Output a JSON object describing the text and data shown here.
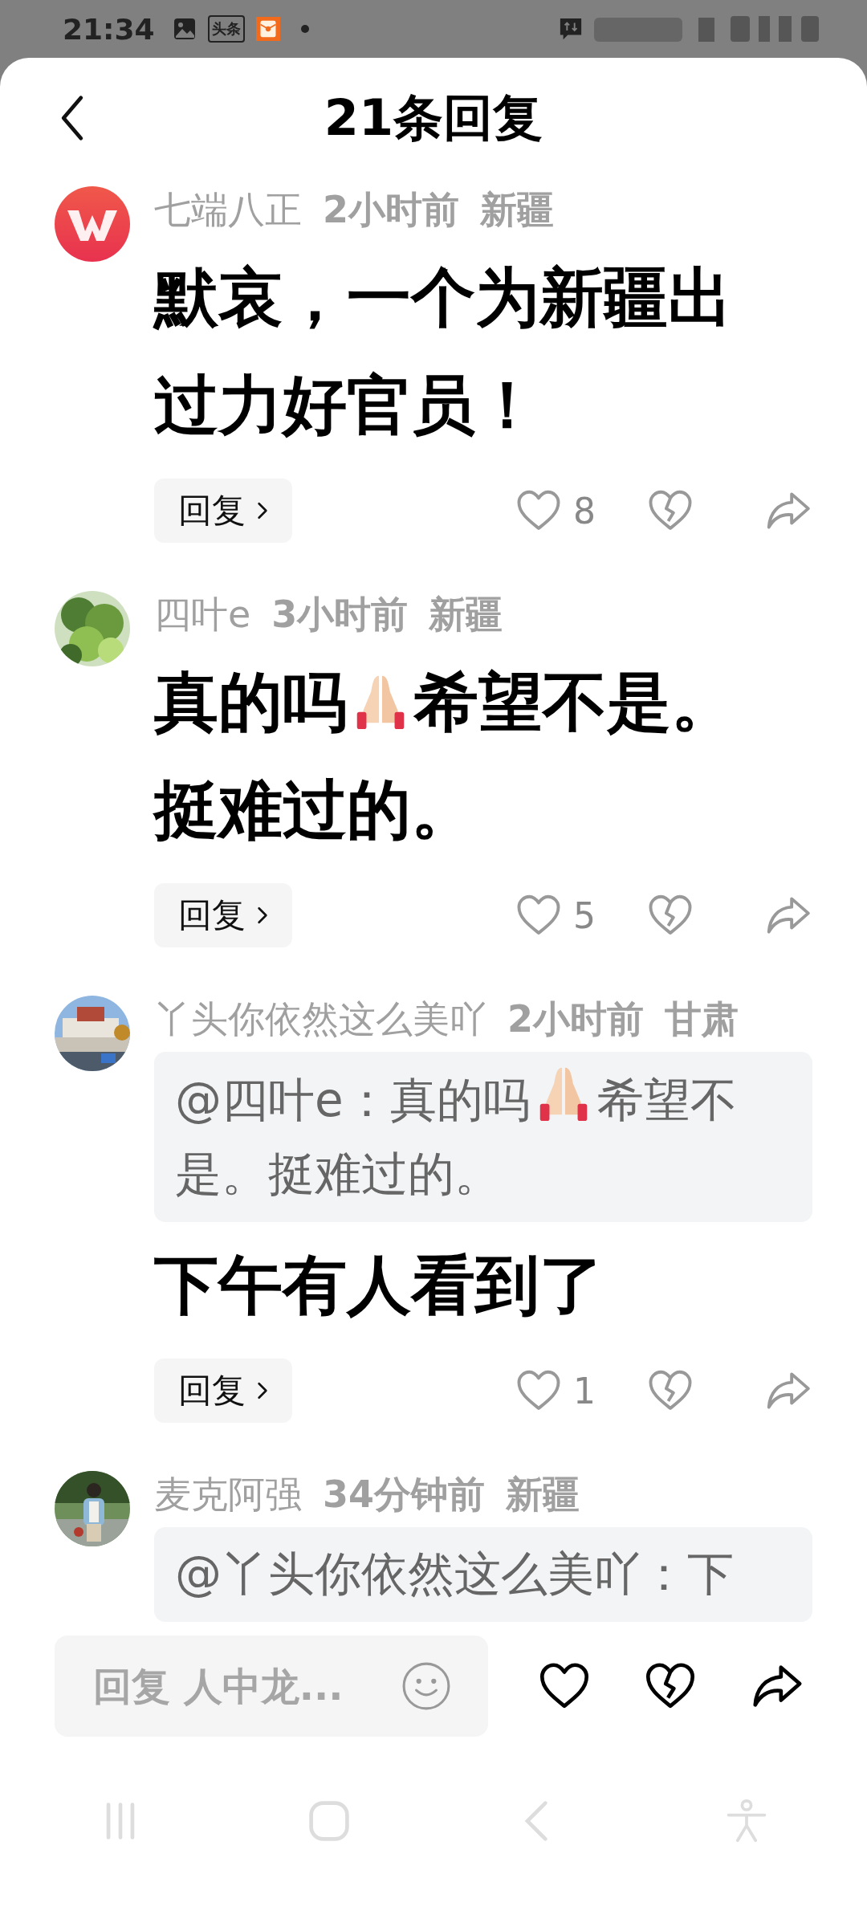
{
  "status_bar": {
    "time": "21:34",
    "app_badge": "头条"
  },
  "header": {
    "title": "21条回复"
  },
  "comments": [
    {
      "avatar": {
        "kind": "logo"
      },
      "name": "七端八正",
      "time": "2小时前",
      "location": "新疆",
      "body": [
        {
          "kind": "text",
          "text": "默哀，一个为新疆出"
        },
        {
          "kind": "text",
          "text": "过力好官员！"
        }
      ],
      "reply_label": "回复",
      "likes": "8"
    },
    {
      "avatar": {
        "kind": "picture"
      },
      "name": "四叶e",
      "time": "3小时前",
      "location": "新疆",
      "body": [
        {
          "kind": "text",
          "text": "真的吗"
        },
        {
          "kind": "emoji"
        },
        {
          "kind": "text",
          "text": "希望不是。"
        },
        {
          "kind": "text",
          "text": "挺难过的。"
        }
      ],
      "reply_label": "回复",
      "likes": "5"
    },
    {
      "avatar": {
        "kind": "picture"
      },
      "name": "丫头你依然这么美吖",
      "time": "2小时前",
      "location": "甘肃",
      "quote": [
        {
          "kind": "text",
          "text": "@四叶e：真的吗"
        },
        {
          "kind": "emoji"
        },
        {
          "kind": "text",
          "text": "希望不"
        },
        {
          "kind": "text",
          "text": "是。挺难过的。"
        }
      ],
      "body": [
        {
          "kind": "text",
          "text": "下午有人看到了"
        }
      ],
      "reply_label": "回复",
      "likes": "1"
    },
    {
      "avatar": {
        "kind": "picture"
      },
      "name": "麦克阿强",
      "time": "34分钟前",
      "location": "新疆",
      "quote": [
        {
          "kind": "text",
          "text": "@丫头你依然这么美吖：下"
        }
      ]
    }
  ],
  "composer": {
    "placeholder": "回复 人中龙..."
  }
}
